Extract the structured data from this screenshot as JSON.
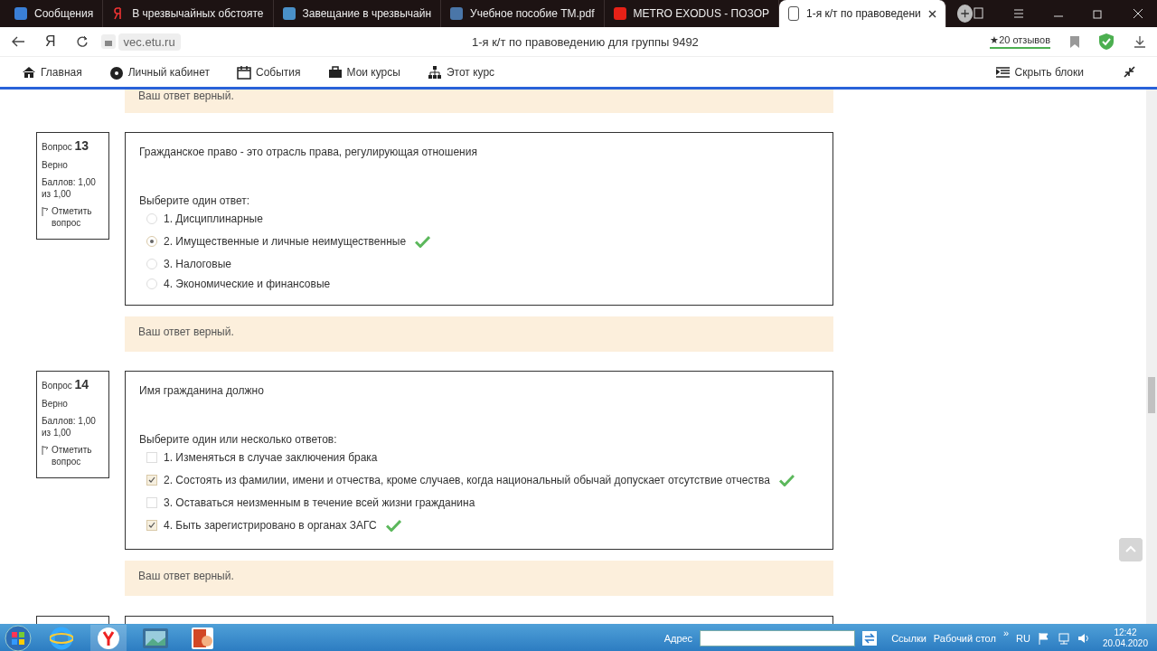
{
  "browser_tabs": [
    {
      "title": "Сообщения",
      "selected": false
    },
    {
      "title": "В чрезвычайных обстояте",
      "selected": false
    },
    {
      "title": "Завещание в чрезвычайн",
      "selected": false
    },
    {
      "title": "Учебное пособие ТМ.pdf",
      "selected": false
    },
    {
      "title": "METRO EXODUS - ПОЗОР",
      "selected": false
    },
    {
      "title": "1-я к/т по правоведени",
      "selected": true
    }
  ],
  "address_bar": {
    "url": "vec.etu.ru",
    "page_title": "1-я к/т по правоведению для группы 9492",
    "reviews": "★20 отзывов",
    "logo": "Я"
  },
  "nav": {
    "items": [
      "Главная",
      "Личный кабинет",
      "События",
      "Мои курсы",
      "Этот курс"
    ],
    "hide_blocks": "Скрыть блоки"
  },
  "top_feedback": "Ваш ответ верный.",
  "questions": [
    {
      "label": "Вопрос",
      "number": "13",
      "state": "Верно",
      "grade": "Баллов: 1,00 из 1,00",
      "flag": "Отметить вопрос",
      "kind": "radio",
      "text": "Гражданское право - это отрасль права, регулирующая отношения",
      "prompt": "Выберите один ответ:",
      "answers": [
        {
          "text": "1. Дисциплинарные",
          "selected": false,
          "correct": false
        },
        {
          "text": "2. Имущественные и личные неимущественные",
          "selected": true,
          "correct": true
        },
        {
          "text": "3. Налоговые",
          "selected": false,
          "correct": false
        },
        {
          "text": "4. Экономические и финансовые",
          "selected": false,
          "correct": false
        }
      ],
      "feedback": "Ваш ответ верный."
    },
    {
      "label": "Вопрос",
      "number": "14",
      "state": "Верно",
      "grade": "Баллов: 1,00 из 1,00",
      "flag": "Отметить вопрос",
      "kind": "checkbox",
      "text": "Имя гражданина должно",
      "prompt": "Выберите один или несколько ответов:",
      "answers": [
        {
          "text": "1. Изменяться в случае заключения брака",
          "selected": false,
          "correct": false
        },
        {
          "text": "2. Состоять из фамилии, имени и отчества, кроме случаев, когда национальный обычай допускает отсутствие отчества",
          "selected": true,
          "correct": true
        },
        {
          "text": "3. Оставаться неизменным в течение всей жизни гражданина",
          "selected": false,
          "correct": false
        },
        {
          "text": "4. Быть зарегистрировано в органах ЗАГС",
          "selected": true,
          "correct": true
        }
      ],
      "feedback": "Ваш ответ верный."
    }
  ],
  "taskbar": {
    "address_label": "Адрес",
    "links": "Ссылки",
    "desktop": "Рабочий стол",
    "more": "»",
    "language": "RU",
    "time": "12:42",
    "date": "20.04.2020"
  }
}
